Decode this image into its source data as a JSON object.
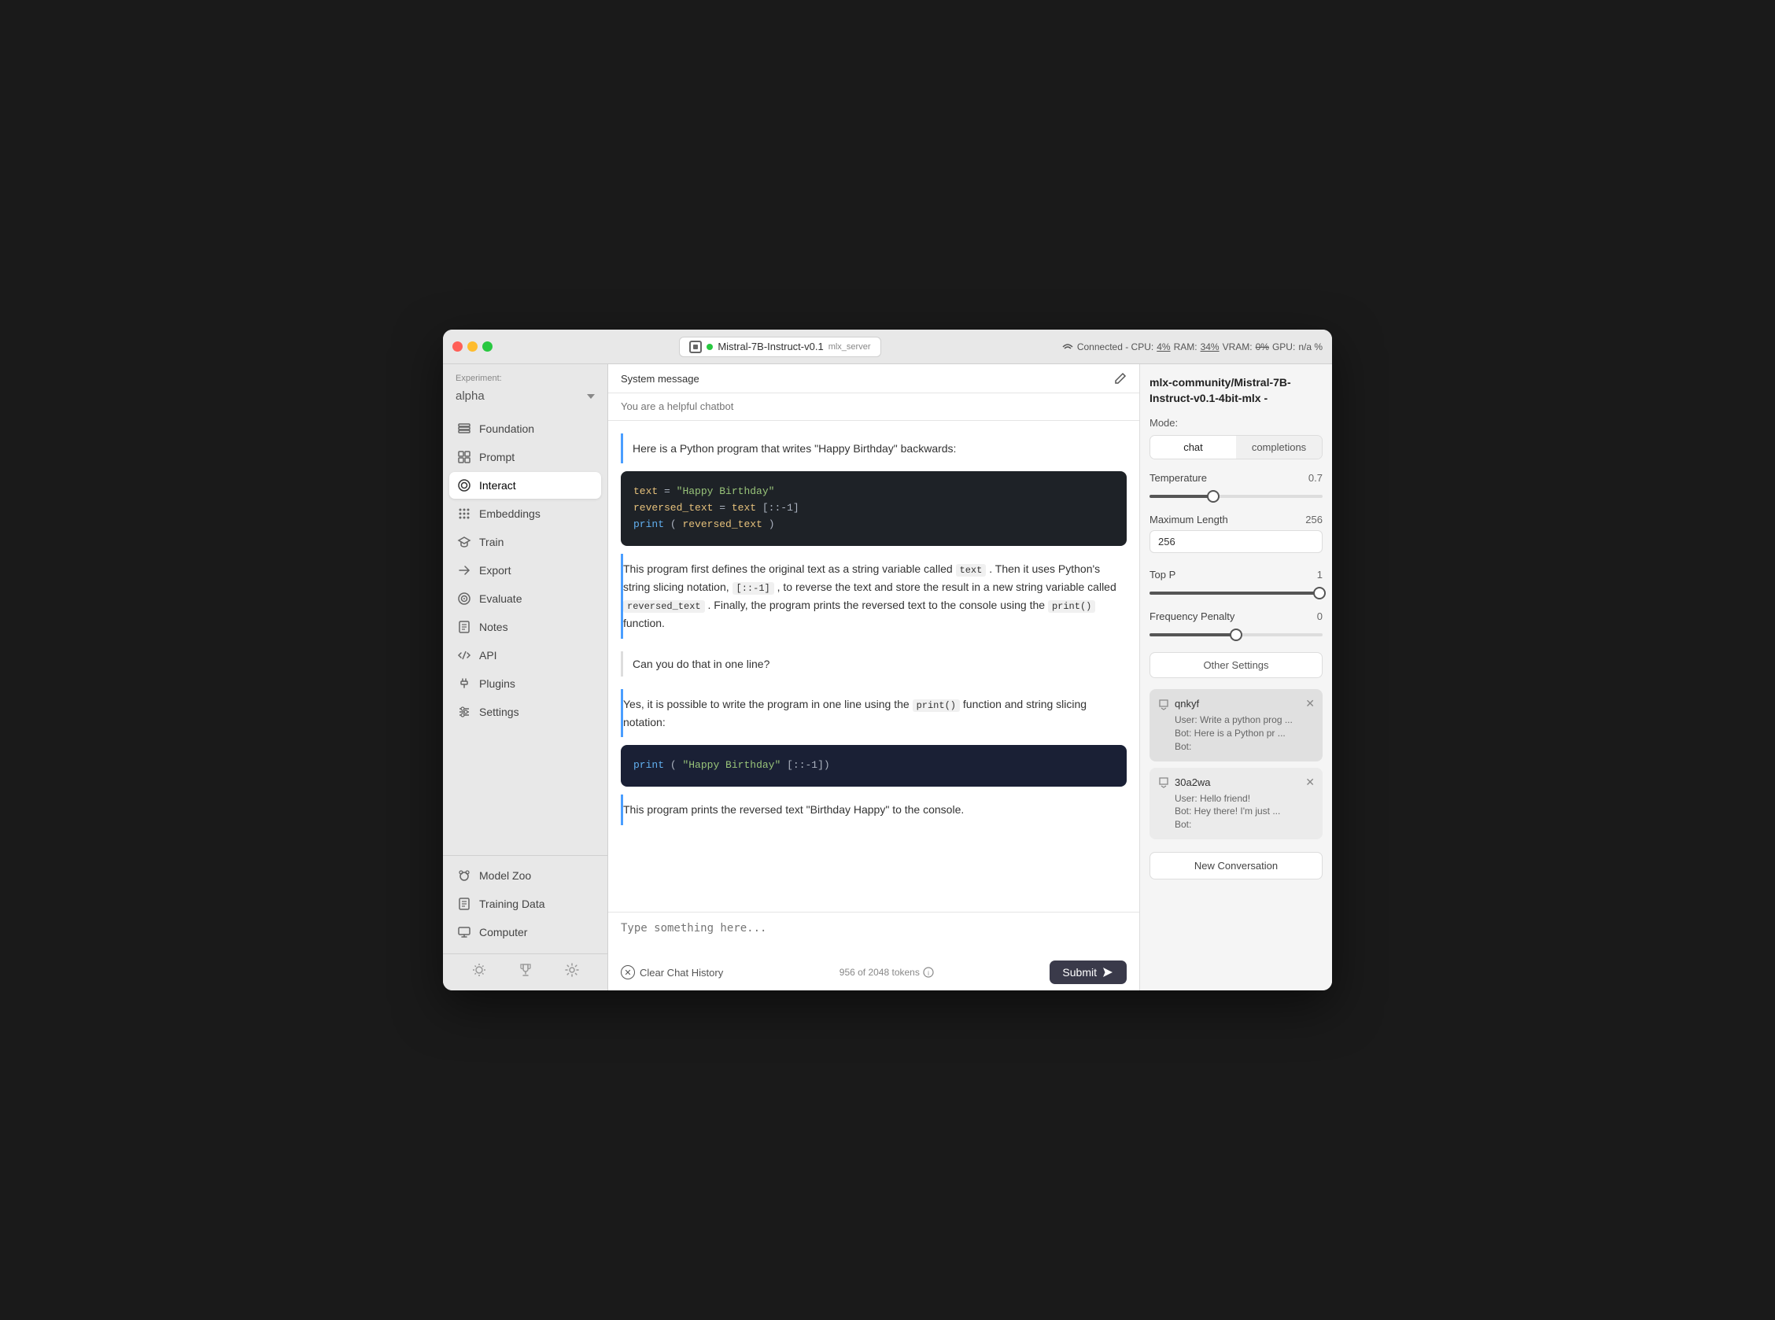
{
  "window": {
    "title": "MLX Server",
    "model_name": "Mistral-7B-Instruct-v0.1",
    "model_suffix": "mlx_server",
    "status": "Connected - CPU:",
    "cpu": "4%",
    "ram_label": "RAM:",
    "ram": "34%",
    "vram_label": "VRAM:",
    "vram": "0%",
    "gpu_label": "GPU:",
    "gpu": "n/a %"
  },
  "sidebar": {
    "experiment_label": "Experiment:",
    "experiment_name": "alpha",
    "nav_items": [
      {
        "id": "foundation",
        "label": "Foundation",
        "icon": "layers"
      },
      {
        "id": "prompt",
        "label": "Prompt",
        "icon": "grid"
      },
      {
        "id": "interact",
        "label": "Interact",
        "icon": "chat-bubble",
        "active": true
      },
      {
        "id": "embeddings",
        "label": "Embeddings",
        "icon": "grid-dots"
      },
      {
        "id": "train",
        "label": "Train",
        "icon": "graduation"
      },
      {
        "id": "export",
        "label": "Export",
        "icon": "arrow-right"
      },
      {
        "id": "evaluate",
        "label": "Evaluate",
        "icon": "target"
      },
      {
        "id": "notes",
        "label": "Notes",
        "icon": "note"
      },
      {
        "id": "api",
        "label": "API",
        "icon": "code"
      },
      {
        "id": "plugins",
        "label": "Plugins",
        "icon": "plug"
      },
      {
        "id": "settings",
        "label": "Settings",
        "icon": "sliders"
      }
    ],
    "bottom_items": [
      {
        "id": "model-zoo",
        "label": "Model Zoo",
        "icon": "animal"
      },
      {
        "id": "training-data",
        "label": "Training Data",
        "icon": "document"
      },
      {
        "id": "computer",
        "label": "Computer",
        "icon": "monitor"
      }
    ],
    "footer_icons": [
      "sun",
      "trophy",
      "gear"
    ]
  },
  "system_message": {
    "label": "System message",
    "placeholder": "You are a helpful chatbot"
  },
  "chat": {
    "messages": [
      {
        "type": "user",
        "text": "Can you do that in one line?"
      },
      {
        "type": "bot_intro",
        "text": "Here is a Python program that writes \"Happy Birthday\" backwards:"
      },
      {
        "type": "code",
        "lines": [
          {
            "tokens": [
              {
                "t": "var",
                "v": "text"
              },
              {
                "t": "op",
                "v": " = "
              },
              {
                "t": "str",
                "v": "\"Happy Birthday\""
              }
            ]
          },
          {
            "tokens": [
              {
                "t": "var",
                "v": "reversed_text"
              },
              {
                "t": "op",
                "v": " = "
              },
              {
                "t": "var",
                "v": "text"
              },
              {
                "t": "op",
                "v": "[::-1]"
              }
            ]
          },
          {
            "tokens": [
              {
                "t": "fn",
                "v": "print"
              },
              {
                "t": "op",
                "v": "("
              },
              {
                "t": "var",
                "v": "reversed_text"
              },
              {
                "t": "op",
                "v": ")"
              }
            ]
          }
        ]
      },
      {
        "type": "bot_text",
        "text": "This program first defines the original text as a string variable called text. Then it uses Python's string slicing notation, [::-1], to reverse the text and store the result in a new string variable called reversed_text. Finally, the program prints the reversed text to the console using the print() function."
      },
      {
        "type": "user2",
        "text": "Can you do that in one line?"
      },
      {
        "type": "bot_text2",
        "text": "Yes, it is possible to write the program in one line using the print() function and string slicing notation:"
      },
      {
        "type": "code2",
        "content": "print(\"Happy Birthday\"[::-1])"
      },
      {
        "type": "bot_text3",
        "text": "This program prints the reversed text \"Birthday Happy\" to the console."
      }
    ],
    "input_placeholder": "Type something here...",
    "clear_button": "Clear Chat History",
    "token_info": "956 of 2048 tokens",
    "submit_button": "Submit"
  },
  "right_panel": {
    "model_title": "mlx-community/Mistral-7B-Instruct-v0.1-4bit-mlx -",
    "mode_label": "Mode:",
    "modes": [
      "chat",
      "completions"
    ],
    "active_mode": "chat",
    "temperature": {
      "label": "Temperature",
      "value": "0.7",
      "percent": 37
    },
    "max_length": {
      "label": "Maximum Length",
      "value_label": "256",
      "input_value": "256"
    },
    "top_p": {
      "label": "Top P",
      "value": "1",
      "percent": 98
    },
    "freq_penalty": {
      "label": "Frequency Penalty",
      "value": "0",
      "percent": 50
    },
    "other_settings_btn": "Other Settings",
    "conversations": [
      {
        "id": "qnkyf",
        "name": "qnkyf",
        "user_preview": "User:  Write a python prog ...",
        "bot_preview": "Bot:  Here is a Python pr ...",
        "bot_preview2": "Bot:"
      },
      {
        "id": "30a2wa",
        "name": "30a2wa",
        "user_preview": "User:  Hello friend!",
        "bot_preview": "Bot:  Hey there! I'm just ...",
        "bot_preview2": "Bot:"
      }
    ],
    "new_conversation_btn": "New Conversation"
  }
}
